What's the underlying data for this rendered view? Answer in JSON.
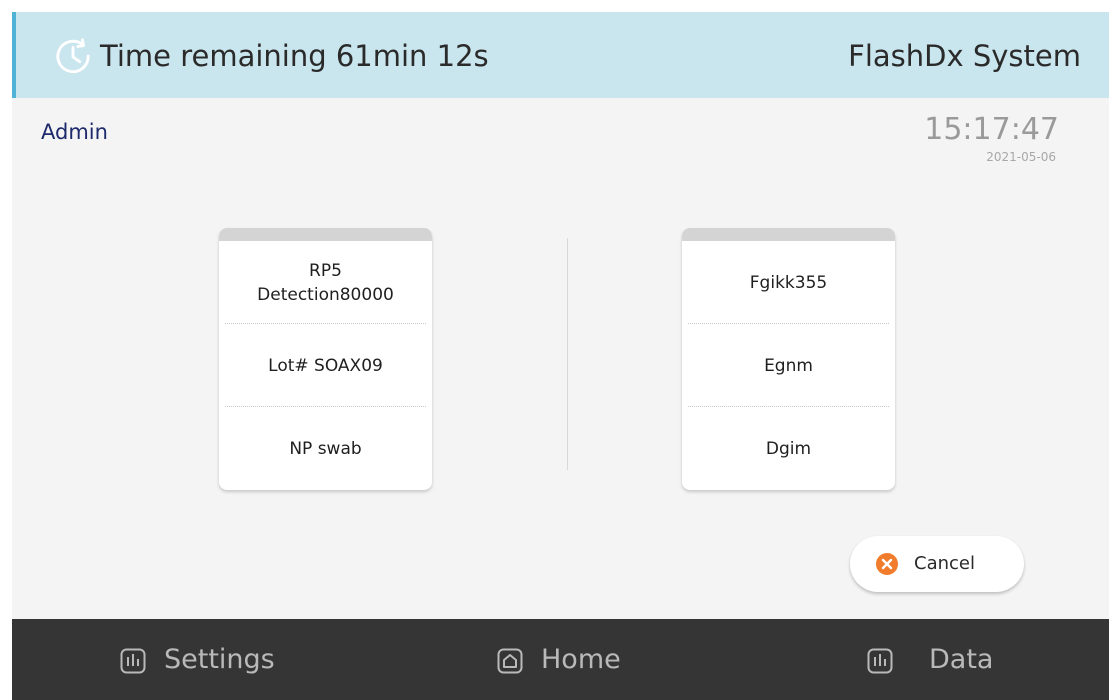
{
  "header": {
    "time_remaining_label": "Time remaining  61min 12s",
    "system_name": "FlashDx System",
    "icon": "clock-refresh-icon"
  },
  "user": {
    "name": "Admin"
  },
  "clock": {
    "time": "15:17:47",
    "date": "2021-05-06"
  },
  "left_card": {
    "row1_line1": "RP5",
    "row1_line2": "Detection80000",
    "row2": "Lot# SOAX09",
    "row3": "NP swab"
  },
  "right_card": {
    "row1": "Fgikk355",
    "row2": "Egnm",
    "row3": "Dgim"
  },
  "cancel_button": {
    "label": "Cancel",
    "icon": "close-circle-icon",
    "color": "#f07c2c"
  },
  "nav": {
    "settings_label": "Settings",
    "home_label": "Home",
    "data_label": "Data"
  },
  "colors": {
    "header_bg": "#c9e5ee",
    "header_accent": "#4fb3d6",
    "nav_bg": "#353535",
    "user_text": "#1c2a6b"
  }
}
